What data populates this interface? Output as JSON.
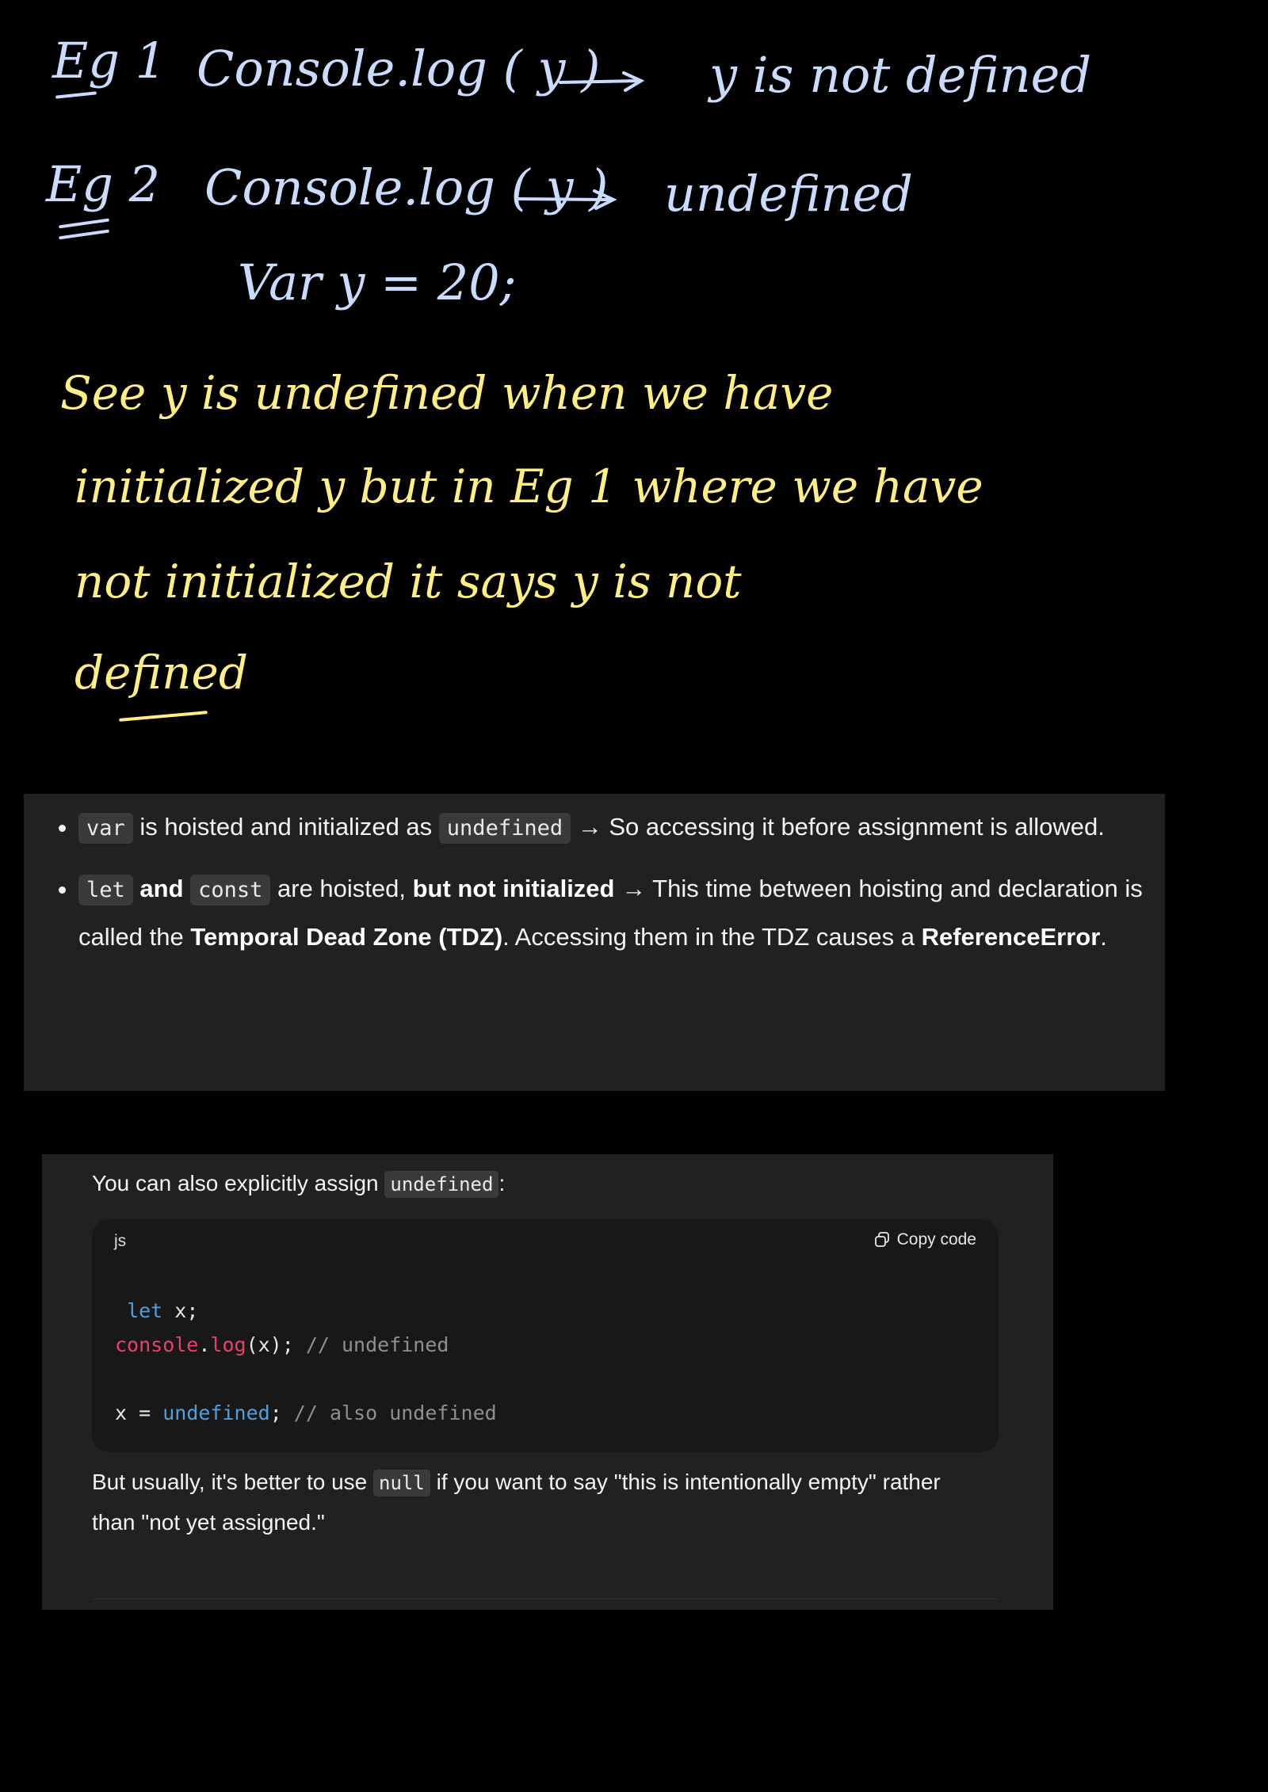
{
  "handwriting": {
    "eg1": {
      "label": "Eg 1",
      "code": "Console.log ( y )",
      "result": "y is not defined"
    },
    "eg2": {
      "label": "Eg 2",
      "code": "Console.log ( y )",
      "result": "undefined",
      "decl": "Var y = 20;"
    },
    "explanation": {
      "line1": "See y is undefined when we have",
      "line2": "initialized y but in Eg 1 where we have",
      "line3": "not initialized it says y is not",
      "line4": "defined"
    }
  },
  "notes": {
    "b1_var": "var",
    "b1_text1": " is hoisted and initialized as ",
    "b1_undef": "undefined",
    "b1_text2": " → So accessing it before assignment is allowed.",
    "b2_let": "let",
    "b2_and": " and ",
    "b2_const": "const",
    "b2_text1": " are hoisted, ",
    "b2_bold1": "but not initialized",
    "b2_text2": " → This time between hoisting and declaration is called the ",
    "b2_bold2": "Temporal Dead Zone (TDZ)",
    "b2_text3": ". Accessing them in the TDZ causes a ",
    "b2_bold3": "ReferenceError",
    "b2_text4": "."
  },
  "chat": {
    "intro_text": "You can also explicitly assign ",
    "intro_code": "undefined",
    "intro_end": ":",
    "code_lang": "js",
    "copy_label": "Copy code",
    "code": {
      "l1_kw": "let",
      "l1_rest": " x;",
      "l2_fn1": "console",
      "l2_dot": ".",
      "l2_fn2": "log",
      "l2_rest": "(x); ",
      "l2_cm": "// undefined",
      "l3_a": "x = ",
      "l3_kw": "undefined",
      "l3_b": ";  ",
      "l3_cm": "// also undefined"
    },
    "outro_text1": "But usually, it's better to use ",
    "outro_code": "null",
    "outro_text2": " if you want to say \"this is intentionally empty\" rather than \"not yet assigned.\""
  }
}
